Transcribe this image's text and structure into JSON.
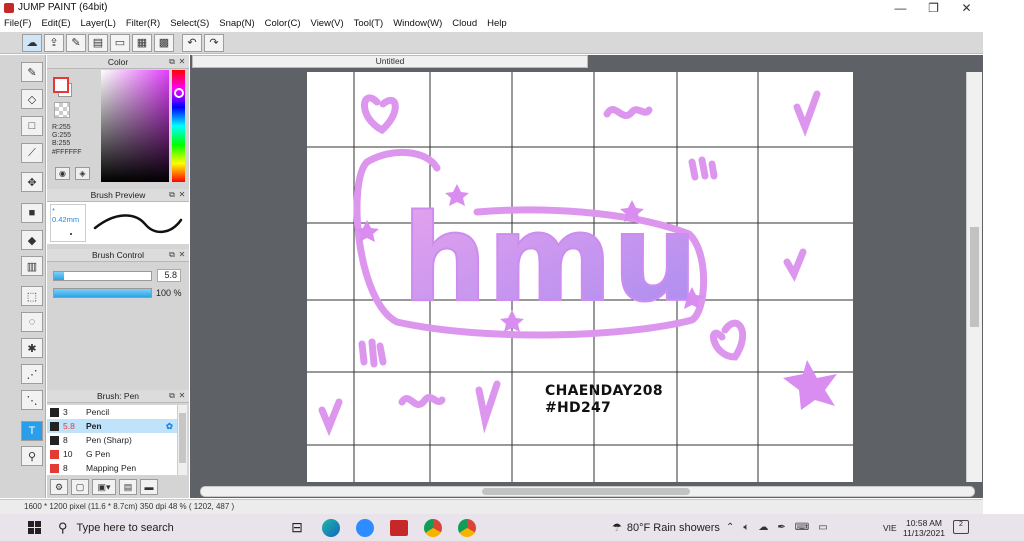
{
  "window": {
    "title": "JUMP PAINT (64bit)",
    "controls": [
      "—",
      "❐",
      "✕"
    ]
  },
  "menu": [
    "File(F)",
    "Edit(E)",
    "Layer(L)",
    "Filter(R)",
    "Select(S)",
    "Snap(N)",
    "Color(C)",
    "View(V)",
    "Tool(T)",
    "Window(W)",
    "Cloud",
    "Help"
  ],
  "color_panel": {
    "title": "Color",
    "rgb": [
      "R:255",
      "G:255",
      "B:255"
    ],
    "hex": "#FFFFFF",
    "foreground_color": "#e53935",
    "hue_color": "#e040fb"
  },
  "brush_preview": {
    "title": "Brush Preview",
    "size_label": "* 0.42mm"
  },
  "brush_control": {
    "title": "Brush Control",
    "size_value": "5.8",
    "size_fraction": 0.1,
    "opacity_value": "100 %",
    "opacity_fraction": 1.0
  },
  "brush_list": {
    "title": "Brush: Pen",
    "items": [
      {
        "num": "3",
        "name": "Pencil",
        "color": "#222222"
      },
      {
        "num": "5.8",
        "name": "Pen",
        "color": "#222222"
      },
      {
        "num": "8",
        "name": "Pen (Sharp)",
        "color": "#222222"
      },
      {
        "num": "10",
        "name": "G Pen",
        "color": "#e53935"
      },
      {
        "num": "8",
        "name": "Mapping Pen",
        "color": "#e53935"
      }
    ]
  },
  "document": {
    "tab_title": "Untitled",
    "caption_line1": "CHAENDAY208",
    "caption_line2": "#HD247",
    "artwork_text": "hmu",
    "accent_color": "#cf8cf0"
  },
  "status": {
    "text": "1600 * 1200 pixel  (11.6 * 8.7cm)  350 dpi  48 %  ( 1202, 487 )"
  },
  "taskbar": {
    "search_placeholder": "Type here to search",
    "weather": "80°F  Rain showers",
    "language": "VIE",
    "time": "10:58 AM",
    "date": "11/13/2021",
    "notifications": "2"
  }
}
